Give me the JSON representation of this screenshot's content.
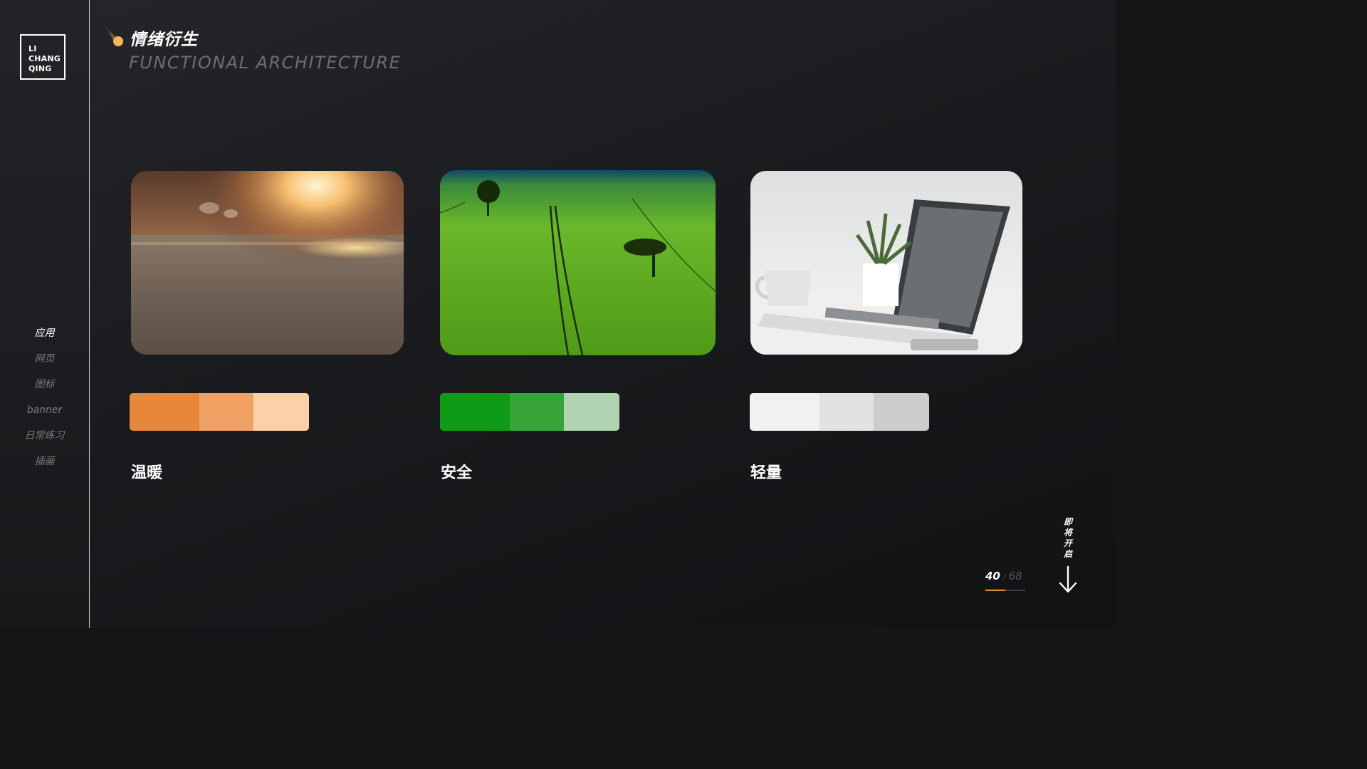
{
  "logo": {
    "lines": [
      "LI",
      "CHANG",
      "QING"
    ]
  },
  "sidebar": {
    "items": [
      {
        "label": "应用",
        "active": true
      },
      {
        "label": "网页",
        "active": false
      },
      {
        "label": "图标",
        "active": false
      },
      {
        "label": "banner",
        "active": false
      },
      {
        "label": "日常练习",
        "active": false
      },
      {
        "label": "插画",
        "active": false
      }
    ]
  },
  "header": {
    "title": "情绪衍生",
    "subtitle": "FUNCTIONAL ARCHITECTURE",
    "accent": "#f3a445"
  },
  "cards": [
    {
      "image": "sunset-road-photo",
      "label": "温暖",
      "colors": [
        "#e8873a",
        "#f1a163",
        "#fdd0aa"
      ],
      "proportions": [
        0.39,
        0.3,
        0.31
      ]
    },
    {
      "image": "green-field-trees-photo",
      "label": "安全",
      "colors": [
        "#0f9b15",
        "#37a43a",
        "#b2d3b2"
      ],
      "proportions": [
        0.39,
        0.3,
        0.31
      ]
    },
    {
      "image": "laptop-desk-plant-photo",
      "label": "轻量",
      "colors": [
        "#f1f1f1",
        "#e2e2e2",
        "#cdcdcd"
      ],
      "proportions": [
        0.39,
        0.3,
        0.31
      ]
    }
  ],
  "pager": {
    "current": "40",
    "separator": "/",
    "total": "68",
    "progress": 0.588
  },
  "coming_soon": [
    "即",
    "将",
    "开",
    "启"
  ],
  "icons": {
    "scroll": "arrow-down-icon",
    "header": "comet-dot-icon"
  }
}
